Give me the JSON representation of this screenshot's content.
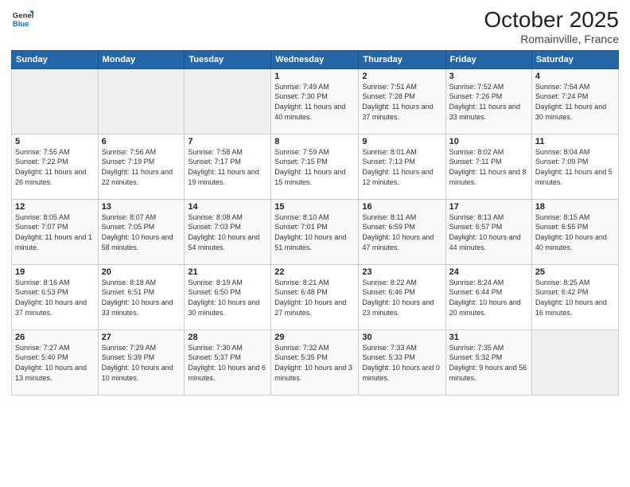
{
  "header": {
    "logo": {
      "general": "General",
      "blue": "Blue"
    },
    "month": "October 2025",
    "location": "Romainville, France"
  },
  "days_of_week": [
    "Sunday",
    "Monday",
    "Tuesday",
    "Wednesday",
    "Thursday",
    "Friday",
    "Saturday"
  ],
  "weeks": [
    [
      {
        "day": "",
        "info": ""
      },
      {
        "day": "",
        "info": ""
      },
      {
        "day": "",
        "info": ""
      },
      {
        "day": "1",
        "info": "Sunrise: 7:49 AM\nSunset: 7:30 PM\nDaylight: 11 hours and 40 minutes."
      },
      {
        "day": "2",
        "info": "Sunrise: 7:51 AM\nSunset: 7:28 PM\nDaylight: 11 hours and 37 minutes."
      },
      {
        "day": "3",
        "info": "Sunrise: 7:52 AM\nSunset: 7:26 PM\nDaylight: 11 hours and 33 minutes."
      },
      {
        "day": "4",
        "info": "Sunrise: 7:54 AM\nSunset: 7:24 PM\nDaylight: 11 hours and 30 minutes."
      }
    ],
    [
      {
        "day": "5",
        "info": "Sunrise: 7:55 AM\nSunset: 7:22 PM\nDaylight: 11 hours and 26 minutes."
      },
      {
        "day": "6",
        "info": "Sunrise: 7:56 AM\nSunset: 7:19 PM\nDaylight: 11 hours and 22 minutes."
      },
      {
        "day": "7",
        "info": "Sunrise: 7:58 AM\nSunset: 7:17 PM\nDaylight: 11 hours and 19 minutes."
      },
      {
        "day": "8",
        "info": "Sunrise: 7:59 AM\nSunset: 7:15 PM\nDaylight: 11 hours and 15 minutes."
      },
      {
        "day": "9",
        "info": "Sunrise: 8:01 AM\nSunset: 7:13 PM\nDaylight: 11 hours and 12 minutes."
      },
      {
        "day": "10",
        "info": "Sunrise: 8:02 AM\nSunset: 7:11 PM\nDaylight: 11 hours and 8 minutes."
      },
      {
        "day": "11",
        "info": "Sunrise: 8:04 AM\nSunset: 7:09 PM\nDaylight: 11 hours and 5 minutes."
      }
    ],
    [
      {
        "day": "12",
        "info": "Sunrise: 8:05 AM\nSunset: 7:07 PM\nDaylight: 11 hours and 1 minute."
      },
      {
        "day": "13",
        "info": "Sunrise: 8:07 AM\nSunset: 7:05 PM\nDaylight: 10 hours and 58 minutes."
      },
      {
        "day": "14",
        "info": "Sunrise: 8:08 AM\nSunset: 7:03 PM\nDaylight: 10 hours and 54 minutes."
      },
      {
        "day": "15",
        "info": "Sunrise: 8:10 AM\nSunset: 7:01 PM\nDaylight: 10 hours and 51 minutes."
      },
      {
        "day": "16",
        "info": "Sunrise: 8:11 AM\nSunset: 6:59 PM\nDaylight: 10 hours and 47 minutes."
      },
      {
        "day": "17",
        "info": "Sunrise: 8:13 AM\nSunset: 6:57 PM\nDaylight: 10 hours and 44 minutes."
      },
      {
        "day": "18",
        "info": "Sunrise: 8:15 AM\nSunset: 6:55 PM\nDaylight: 10 hours and 40 minutes."
      }
    ],
    [
      {
        "day": "19",
        "info": "Sunrise: 8:16 AM\nSunset: 6:53 PM\nDaylight: 10 hours and 37 minutes."
      },
      {
        "day": "20",
        "info": "Sunrise: 8:18 AM\nSunset: 6:51 PM\nDaylight: 10 hours and 33 minutes."
      },
      {
        "day": "21",
        "info": "Sunrise: 8:19 AM\nSunset: 6:50 PM\nDaylight: 10 hours and 30 minutes."
      },
      {
        "day": "22",
        "info": "Sunrise: 8:21 AM\nSunset: 6:48 PM\nDaylight: 10 hours and 27 minutes."
      },
      {
        "day": "23",
        "info": "Sunrise: 8:22 AM\nSunset: 6:46 PM\nDaylight: 10 hours and 23 minutes."
      },
      {
        "day": "24",
        "info": "Sunrise: 8:24 AM\nSunset: 6:44 PM\nDaylight: 10 hours and 20 minutes."
      },
      {
        "day": "25",
        "info": "Sunrise: 8:25 AM\nSunset: 6:42 PM\nDaylight: 10 hours and 16 minutes."
      }
    ],
    [
      {
        "day": "26",
        "info": "Sunrise: 7:27 AM\nSunset: 5:40 PM\nDaylight: 10 hours and 13 minutes."
      },
      {
        "day": "27",
        "info": "Sunrise: 7:29 AM\nSunset: 5:39 PM\nDaylight: 10 hours and 10 minutes."
      },
      {
        "day": "28",
        "info": "Sunrise: 7:30 AM\nSunset: 5:37 PM\nDaylight: 10 hours and 6 minutes."
      },
      {
        "day": "29",
        "info": "Sunrise: 7:32 AM\nSunset: 5:35 PM\nDaylight: 10 hours and 3 minutes."
      },
      {
        "day": "30",
        "info": "Sunrise: 7:33 AM\nSunset: 5:33 PM\nDaylight: 10 hours and 0 minutes."
      },
      {
        "day": "31",
        "info": "Sunrise: 7:35 AM\nSunset: 5:32 PM\nDaylight: 9 hours and 56 minutes."
      },
      {
        "day": "",
        "info": ""
      }
    ]
  ]
}
